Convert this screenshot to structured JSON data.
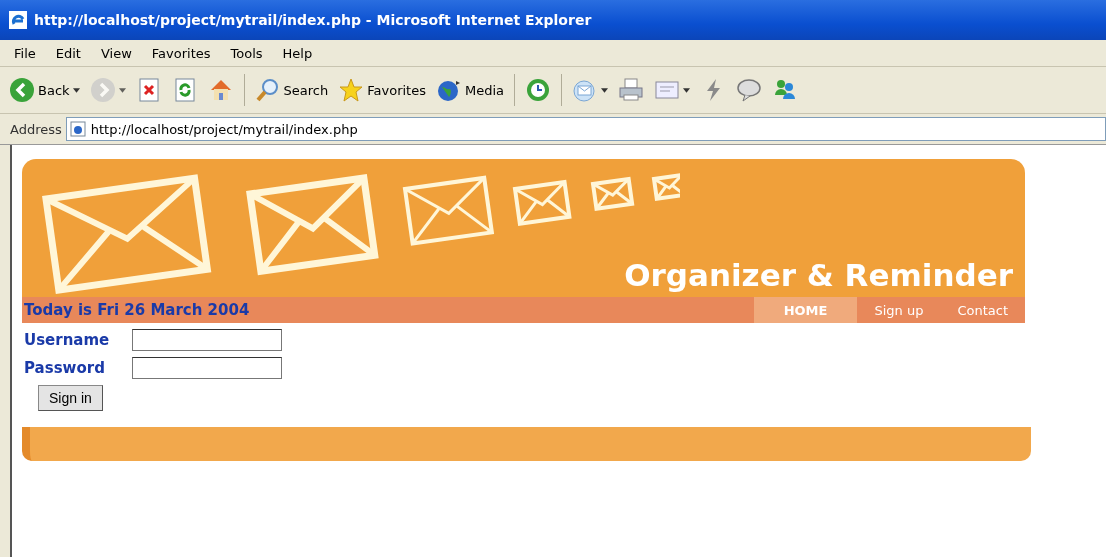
{
  "window": {
    "title": "http://localhost/project/mytrail/index.php - Microsoft Internet Explorer"
  },
  "menu": [
    "File",
    "Edit",
    "View",
    "Favorites",
    "Tools",
    "Help"
  ],
  "toolbar": [
    {
      "label": "Back",
      "dropdown": true,
      "disabled": false
    },
    {
      "dropdown": true,
      "disabled": true
    },
    {
      "dropdown": false,
      "disabled": false
    },
    {
      "dropdown": false,
      "disabled": false
    },
    {
      "dropdown": false,
      "disabled": false
    },
    {
      "label": "Search",
      "dropdown": false,
      "disabled": false
    },
    {
      "label": "Favorites",
      "dropdown": false,
      "disabled": false
    },
    {
      "label": "Media",
      "dropdown": false,
      "disabled": false
    },
    {
      "dropdown": false,
      "disabled": false
    },
    {
      "dropdown": true,
      "disabled": false
    },
    {
      "dropdown": false,
      "disabled": false
    },
    {
      "dropdown": true,
      "disabled": false
    },
    {
      "dropdown": false,
      "disabled": false
    },
    {
      "dropdown": false,
      "disabled": false
    },
    {
      "dropdown": false,
      "disabled": false
    }
  ],
  "address": {
    "label": "Address",
    "value": "http://localhost/project/mytrail/index.php"
  },
  "page": {
    "banner_title": "Organizer & Reminder",
    "date": "Today is Fri 26 March 2004",
    "nav": [
      {
        "label": "HOME",
        "selected": true
      },
      {
        "label": "Sign up",
        "selected": false
      },
      {
        "label": "Contact",
        "selected": false
      }
    ],
    "login": {
      "fields": [
        {
          "label": "Username"
        },
        {
          "label": "Password"
        }
      ],
      "button": "Sign in"
    }
  }
}
